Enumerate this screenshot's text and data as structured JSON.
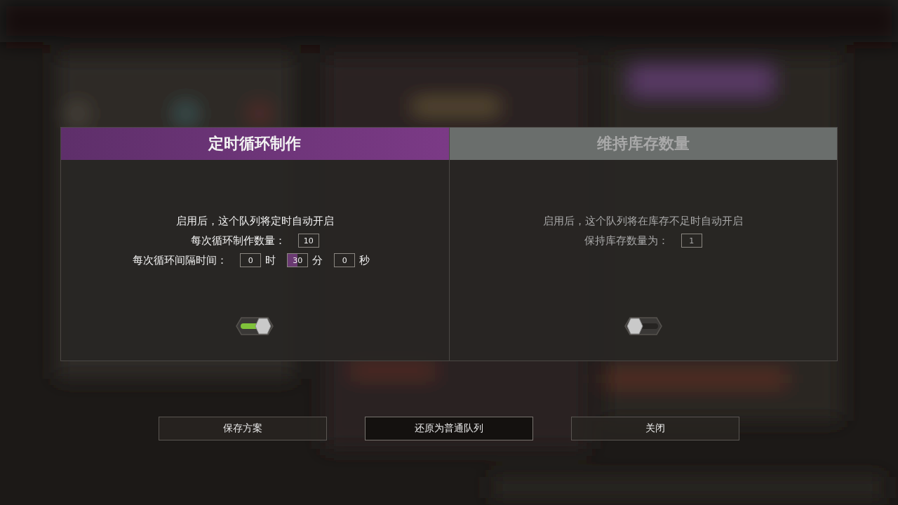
{
  "modes": [
    {
      "title": "定时循环制作",
      "selected": true,
      "description": "启用后，这个队列将定时自动开启",
      "on": true,
      "rows": [
        {
          "label": "每次循环制作数量：",
          "inputs": [
            {
              "value": "10",
              "focused": false
            }
          ]
        },
        {
          "label": "每次循环间隔时间：",
          "inputs": [
            {
              "value": "0",
              "unit": "时",
              "focused": false
            },
            {
              "value": "30",
              "unit": "分",
              "focused": true
            },
            {
              "value": "0",
              "unit": "秒",
              "focused": false
            }
          ]
        }
      ]
    },
    {
      "title": "维持库存数量",
      "selected": false,
      "description": "启用后，这个队列将在库存不足时自动开启",
      "on": false,
      "rows": [
        {
          "label": "保持库存数量为：",
          "inputs": [
            {
              "value": "1",
              "focused": false
            }
          ]
        }
      ]
    }
  ],
  "buttons": [
    {
      "label": "保存方案",
      "highlighted": false
    },
    {
      "label": "还原为普通队列",
      "highlighted": true
    },
    {
      "label": "关闭",
      "highlighted": false
    }
  ]
}
